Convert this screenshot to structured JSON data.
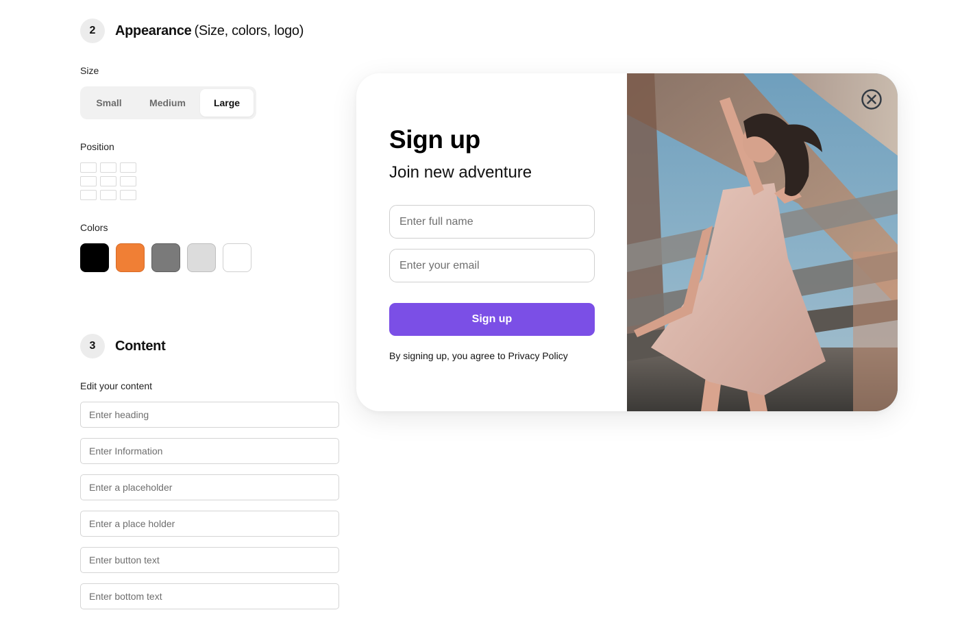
{
  "appearance": {
    "step": "2",
    "title": "Appearance",
    "subtitle": "(Size, colors, logo)",
    "size_label": "Size",
    "size_options": [
      "Small",
      "Medium",
      "Large"
    ],
    "size_selected": "Large",
    "position_label": "Position",
    "colors_label": "Colors",
    "colors": [
      "#000000",
      "#f07f35",
      "#7a7a7a",
      "#dcdcdc",
      "#ffffff"
    ]
  },
  "content": {
    "step": "3",
    "title": "Content",
    "edit_label": "Edit your content",
    "fields": [
      {
        "placeholder": "Enter heading"
      },
      {
        "placeholder": "Enter Information"
      },
      {
        "placeholder": "Enter a placeholder"
      },
      {
        "placeholder": "Enter a place holder"
      },
      {
        "placeholder": "Enter button text"
      },
      {
        "placeholder": "Enter bottom text"
      }
    ]
  },
  "preview": {
    "heading": "Sign up",
    "information": "Join new adventure",
    "name_placeholder": "Enter full name",
    "email_placeholder": "Enter your email",
    "button_text": "Sign up",
    "bottom_text": "By signing up, you agree to Privacy Policy",
    "accent_color": "#7b4fe6",
    "close_icon": "close-circle-icon",
    "image_description_icon": "photo"
  }
}
